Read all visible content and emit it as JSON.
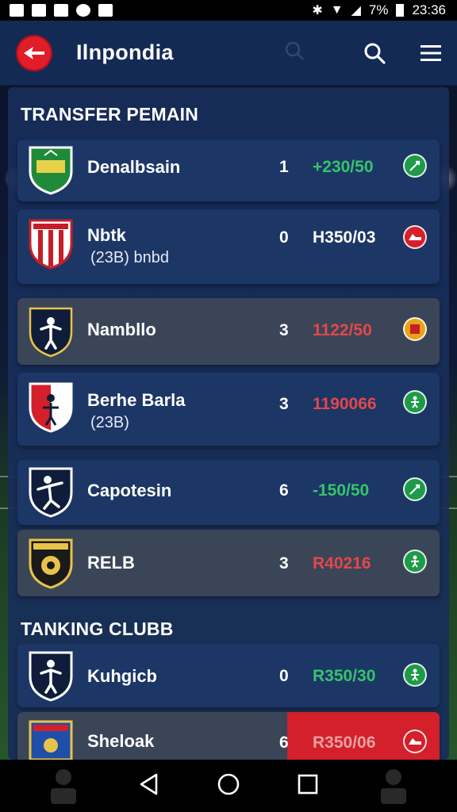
{
  "status_bar": {
    "battery_percent": "7%",
    "time": "23:36"
  },
  "app": {
    "title": "Ilnpondia",
    "logo_icon": "bird-logo-icon",
    "search_icon": "search-icon",
    "menu_icon": "hamburger-menu-icon"
  },
  "sections": {
    "transfer_title": "TRANSFER PEMAIN",
    "tanking_title": "TANKING CLUBB"
  },
  "transfer_rows": [
    {
      "name": "Denalbsain",
      "sub": "",
      "count": "1",
      "value": "+230/50",
      "value_color": "#35c46a",
      "status_color": "#1f9a48",
      "status_icon": "whistle-icon"
    },
    {
      "name": "Nbtk",
      "sub": "(23B)   bnbd",
      "count": "0",
      "value": "H350/03",
      "value_color": "#ffffff",
      "status_color": "#d3202a",
      "status_icon": "shoe-icon"
    },
    {
      "name": "Nambllo",
      "sub": "",
      "count": "3",
      "value": "1122/50",
      "value_color": "#e34848",
      "status_color": "#e8a21a",
      "status_icon": "flag-icon"
    },
    {
      "name": "Berhe Barla",
      "sub": "(23B)",
      "count": "3",
      "value": "1190066",
      "value_color": "#e34848",
      "status_color": "#1f9a48",
      "status_icon": "player-icon"
    },
    {
      "name": "Capotesin",
      "sub": "",
      "count": "6",
      "value": "-150/50",
      "value_color": "#35c46a",
      "status_color": "#1f9a48",
      "status_icon": "whistle-icon"
    },
    {
      "name": "RELB",
      "sub": "",
      "count": "3",
      "value": "R40216",
      "value_color": "#e34848",
      "status_color": "#1f9a48",
      "status_icon": "player-icon"
    }
  ],
  "tanking_rows": [
    {
      "name": "Kuhgicb",
      "count": "0",
      "value": "R350/30",
      "value_color": "#35c46a",
      "status_color": "#1f9a48",
      "status_icon": "player-icon"
    },
    {
      "name": "Sheloak",
      "count": "6",
      "value": "R350/06",
      "value_color": "#e8a0a0",
      "status_color": "#d3202a",
      "status_icon": "shoe-icon"
    }
  ],
  "navbar": {
    "back_icon": "back-triangle-icon",
    "home_icon": "home-circle-icon",
    "recents_icon": "recents-square-icon"
  },
  "colors": {
    "accent": "#e11d2a",
    "appbar": "#132a55",
    "row_blue": "#1c3666",
    "row_gray": "#3b4558",
    "positive": "#35c46a",
    "negative": "#e34848"
  }
}
